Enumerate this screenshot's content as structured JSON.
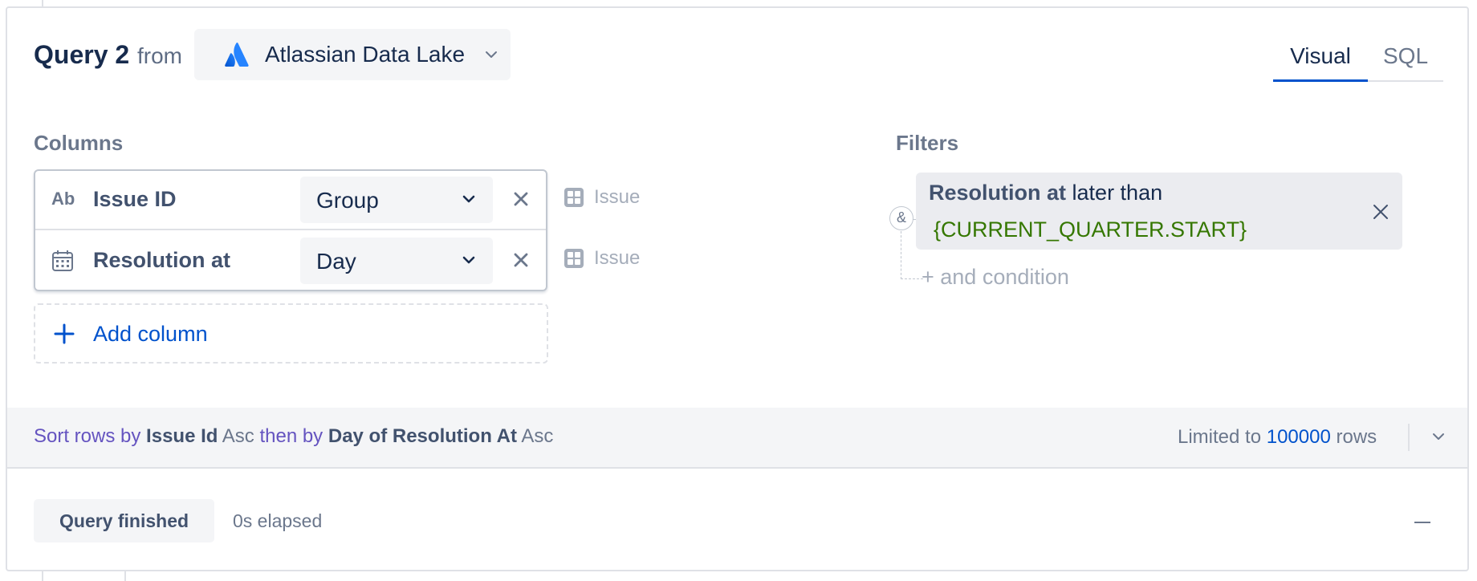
{
  "header": {
    "query_title": "Query 2",
    "from_label": "from",
    "data_source": "Atlassian Data Lake",
    "tabs": [
      {
        "label": "Visual",
        "active": true
      },
      {
        "label": "SQL",
        "active": false
      }
    ]
  },
  "columns": {
    "section_title": "Columns",
    "items": [
      {
        "type_icon": "text-type-icon",
        "type_glyph": "Ab",
        "name": "Issue ID",
        "aggregation": "Group",
        "source": "Issue"
      },
      {
        "type_icon": "calendar-icon",
        "name": "Resolution at",
        "aggregation": "Day",
        "source": "Issue"
      }
    ],
    "add_label": "Add column"
  },
  "filters": {
    "section_title": "Filters",
    "conjunction": "&",
    "items": [
      {
        "field": "Resolution at",
        "operator": "later than",
        "value": "{CURRENT_QUARTER.START}"
      }
    ],
    "add_condition_label": "+ and condition"
  },
  "sort": {
    "prefix": "Sort rows by",
    "first_field": "Issue Id",
    "first_dir": "Asc",
    "then_label": "then by",
    "second_field": "Day of Resolution At",
    "second_dir": "Asc",
    "limit_prefix": "Limited to",
    "limit_value": "100000",
    "limit_suffix": "rows"
  },
  "status": {
    "badge": "Query finished",
    "elapsed": "0s elapsed"
  },
  "colors": {
    "accent": "#0052cc",
    "filter_value": "#357700",
    "sort_keyword": "#6554c0"
  }
}
